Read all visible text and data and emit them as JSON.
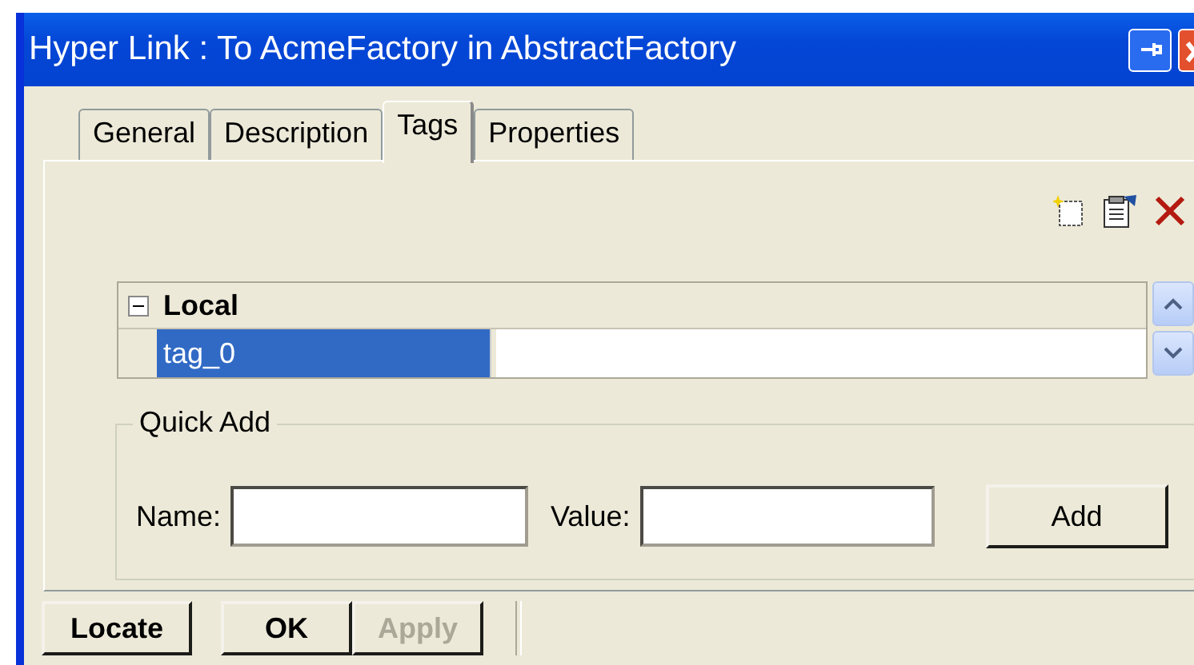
{
  "window": {
    "title": "Hyper Link : To AcmeFactory in AbstractFactory"
  },
  "tabs": [
    {
      "label": "General",
      "selected": false
    },
    {
      "label": "Description",
      "selected": false
    },
    {
      "label": "Tags",
      "selected": true
    },
    {
      "label": "Properties",
      "selected": false
    }
  ],
  "tags_grid": {
    "group": {
      "label": "Local",
      "expanded": true,
      "rows": [
        {
          "name": "tag_0",
          "selected": true
        }
      ]
    }
  },
  "quick_add": {
    "title": "Quick Add",
    "name_label": "Name:",
    "value_label": "Value:",
    "add_button": "Add"
  },
  "buttons": [
    {
      "label": "Locate",
      "disabled": false
    },
    {
      "label": "OK",
      "disabled": false
    },
    {
      "label": "Apply",
      "disabled": true
    }
  ]
}
